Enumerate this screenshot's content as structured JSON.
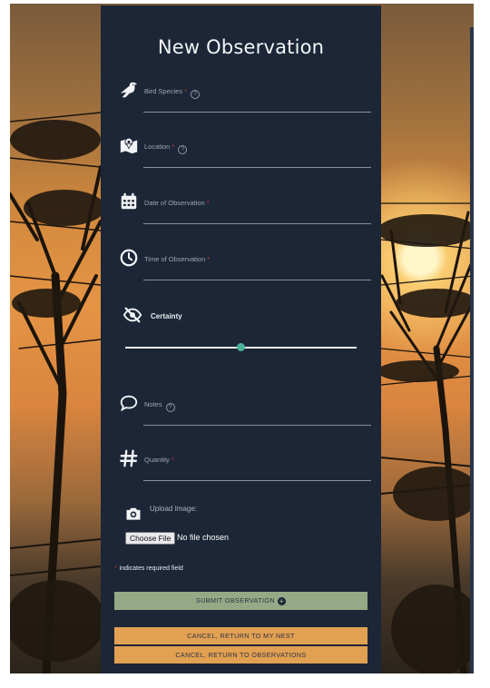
{
  "form": {
    "title": "New Observation",
    "fields": [
      {
        "id": "species",
        "label": "Bird Species",
        "required": true,
        "help": true,
        "icon": "bird-icon"
      },
      {
        "id": "location",
        "label": "Location",
        "required": true,
        "help": true,
        "icon": "map-marker-icon"
      },
      {
        "id": "date",
        "label": "Date of Observation",
        "required": true,
        "help": false,
        "icon": "calendar-icon"
      },
      {
        "id": "time",
        "label": "Time of Observation",
        "required": true,
        "help": false,
        "icon": "clock-icon"
      },
      {
        "id": "notes",
        "label": "Notes",
        "required": false,
        "help": true,
        "icon": "speech-bubble-icon"
      },
      {
        "id": "quantity",
        "label": "Quantity",
        "required": true,
        "help": false,
        "icon": "hash-icon"
      }
    ],
    "required_marker": "*",
    "help_glyph": "?",
    "certainty": {
      "label": "Certainty",
      "icon": "eye-slash-icon",
      "value": 0.5
    },
    "upload": {
      "label": "Upload Image:",
      "button": "Choose File",
      "status": "No file chosen",
      "icon": "camera-icon"
    },
    "required_note": "indicates required field",
    "buttons": {
      "submit": "SUBMIT OBSERVATION",
      "submit_icon": "plus-circle-icon",
      "cancel_nest": "CANCEL, RETURN TO MY NEST",
      "cancel_observations": "CANCEL, RETURN TO OBSERVATIONS"
    }
  },
  "colors": {
    "panel": "#1c2637",
    "submit": "#94aa86",
    "cancel": "#e2a052",
    "slider_thumb": "#4bb39a",
    "required": "#c0392b"
  }
}
